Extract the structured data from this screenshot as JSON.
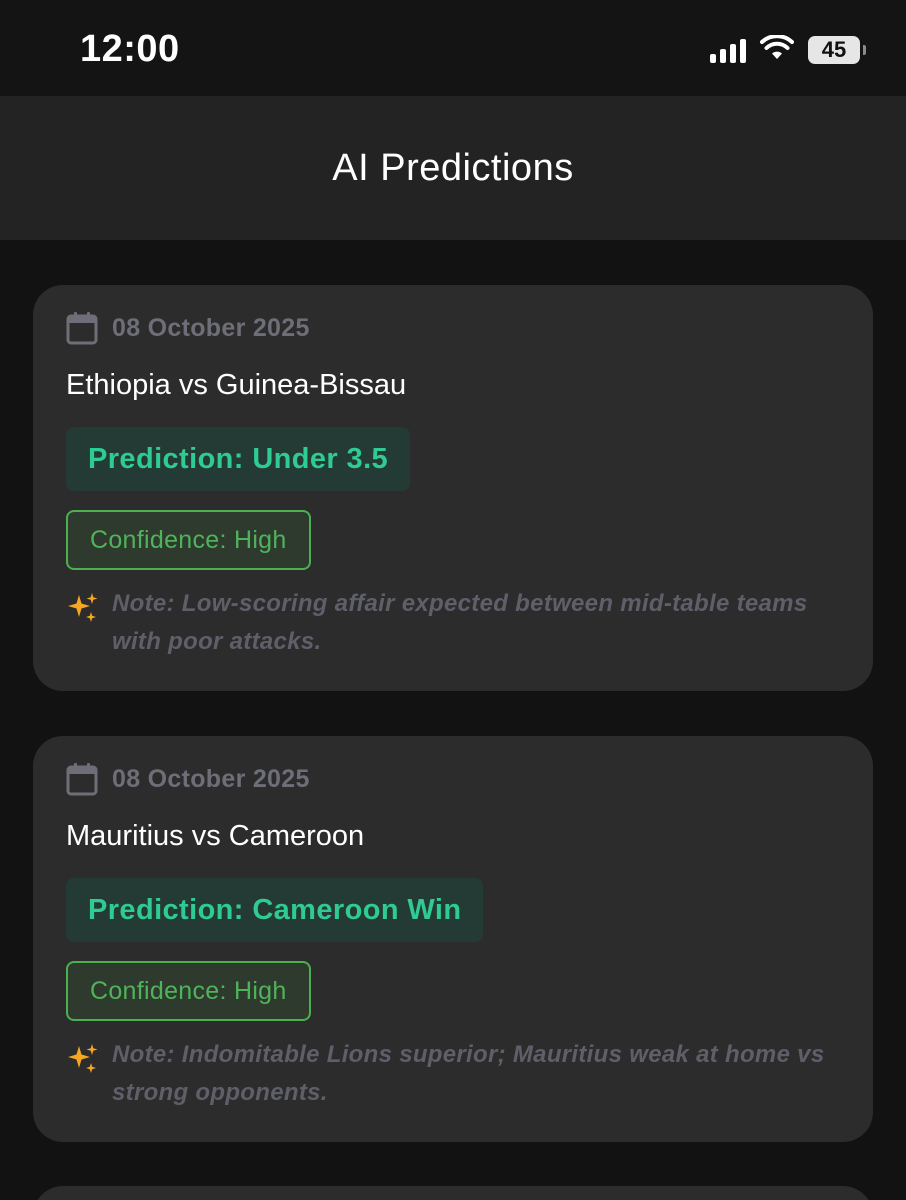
{
  "status_bar": {
    "time": "12:00",
    "battery": "45",
    "icons": [
      "signal-icon",
      "wifi-icon",
      "battery-icon"
    ]
  },
  "header": {
    "title": "AI Predictions"
  },
  "colors": {
    "background": "#121212",
    "card": "#2c2c2c",
    "prediction_accent": "#2ecb93",
    "confidence_accent": "#4caf50",
    "note_icon": "#f5a623"
  },
  "predictions": [
    {
      "date": "08 October 2025",
      "match": "Ethiopia vs Guinea-Bissau",
      "prediction": "Prediction: Under 3.5",
      "confidence": "Confidence: High",
      "note": "Note: Low-scoring affair expected between mid-table teams with poor attacks."
    },
    {
      "date": "08 October 2025",
      "match": "Mauritius vs Cameroon",
      "prediction": "Prediction: Cameroon Win",
      "confidence": "Confidence: High",
      "note": "Note: Indomitable Lions superior; Mauritius weak at home vs strong opponents."
    }
  ]
}
